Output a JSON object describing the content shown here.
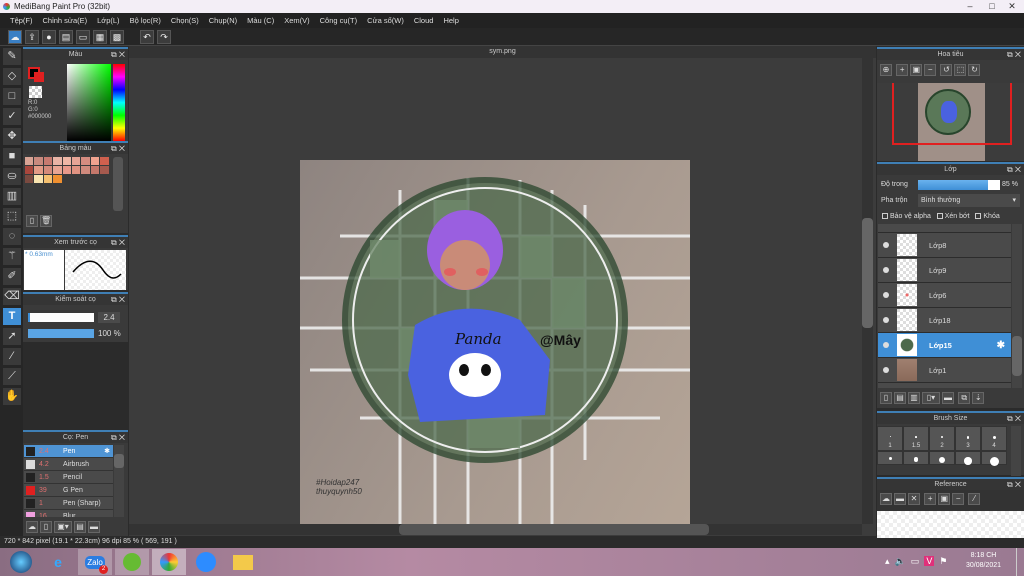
{
  "app": {
    "title": "MediBang Paint Pro (32bit)"
  },
  "menu": [
    "Tệp(F)",
    "Chỉnh sửa(E)",
    "Lớp(L)",
    "Bộ lọc(R)",
    "Chọn(S)",
    "Chụp(N)",
    "Màu (C)",
    "Xem(V)",
    "Công cụ(T)",
    "Cửa sổ(W)",
    "Cloud",
    "Help"
  ],
  "color_panel": {
    "title": "Màu",
    "r": "R:0",
    "g": "G:0",
    "hex": "#000000",
    "primary": "#000000",
    "secondary": "#e02020"
  },
  "palette_panel": {
    "title": "Bảng màu",
    "swatches": [
      "#d9a394",
      "#c98a7e",
      "#c77a70",
      "#e8b4a6",
      "#eeb7a6",
      "#e8a596",
      "#d68c80",
      "#f0a38f",
      "#d0604e",
      "#a8463c",
      "#e39b86",
      "#d48a7b",
      "#e8a593",
      "#e8998a",
      "#e19382",
      "#d08a7d",
      "#c5786b",
      "#a65a4e",
      "#7a4a40",
      "#f8e4b0",
      "#f5c070",
      "#f09030"
    ]
  },
  "brush_preview": {
    "title": "Xem trước cọ",
    "size": "* 0.63mm"
  },
  "brush_control": {
    "title": "Kiểm soát cọ",
    "size_value": "2.4",
    "opacity_value": "100 %",
    "opacity": 100
  },
  "brush_list": {
    "title": "Cọ: Pen",
    "items": [
      {
        "size": "2.4",
        "name": "Pen",
        "color": "#222222"
      },
      {
        "size": "4.2",
        "name": "Airbrush",
        "color": "#dddddd"
      },
      {
        "size": "1.5",
        "name": "Pencil",
        "color": "#222222"
      },
      {
        "size": "39",
        "name": "G Pen",
        "color": "#e02020"
      },
      {
        "size": "1",
        "name": "Pen (Sharp)",
        "color": "#222222"
      },
      {
        "size": "16",
        "name": "Blur",
        "color": "#f0a0e0"
      }
    ]
  },
  "canvas": {
    "tab": "sym.png",
    "text_panda": "Panda",
    "text_handle": "@Mây",
    "watermark1": "#Hoidap247",
    "watermark2": "thuyquynh50"
  },
  "status": "720 * 842 pixel   (19.1 * 22.3cm)   96 dpi   85 %   ( 569, 191 )",
  "navigator": {
    "title": "Hoa tiêu"
  },
  "layers": {
    "title": "Lớp",
    "opacity_label": "Độ trong",
    "opacity_value": "85 %",
    "opacity": 85,
    "blend_label": "Pha trộn",
    "blend_value": "Bình thường",
    "protect_alpha": "Bảo vệ alpha",
    "clipping": "Xén bớt",
    "lock": "Khóa",
    "items": [
      {
        "name": "Lớp8"
      },
      {
        "name": "Lớp9"
      },
      {
        "name": "Lớp6"
      },
      {
        "name": "Lớp18"
      },
      {
        "name": "Lớp15",
        "selected": true
      },
      {
        "name": "Lớp1"
      }
    ]
  },
  "brush_size": {
    "title": "Brush Size",
    "sizes": [
      "1",
      "1.5",
      "2",
      "3",
      "4"
    ]
  },
  "reference": {
    "title": "Reference"
  },
  "clock": {
    "time": "8:18 CH",
    "date": "30/08/2021"
  },
  "taskbar": {
    "zalo_badge": "2"
  }
}
